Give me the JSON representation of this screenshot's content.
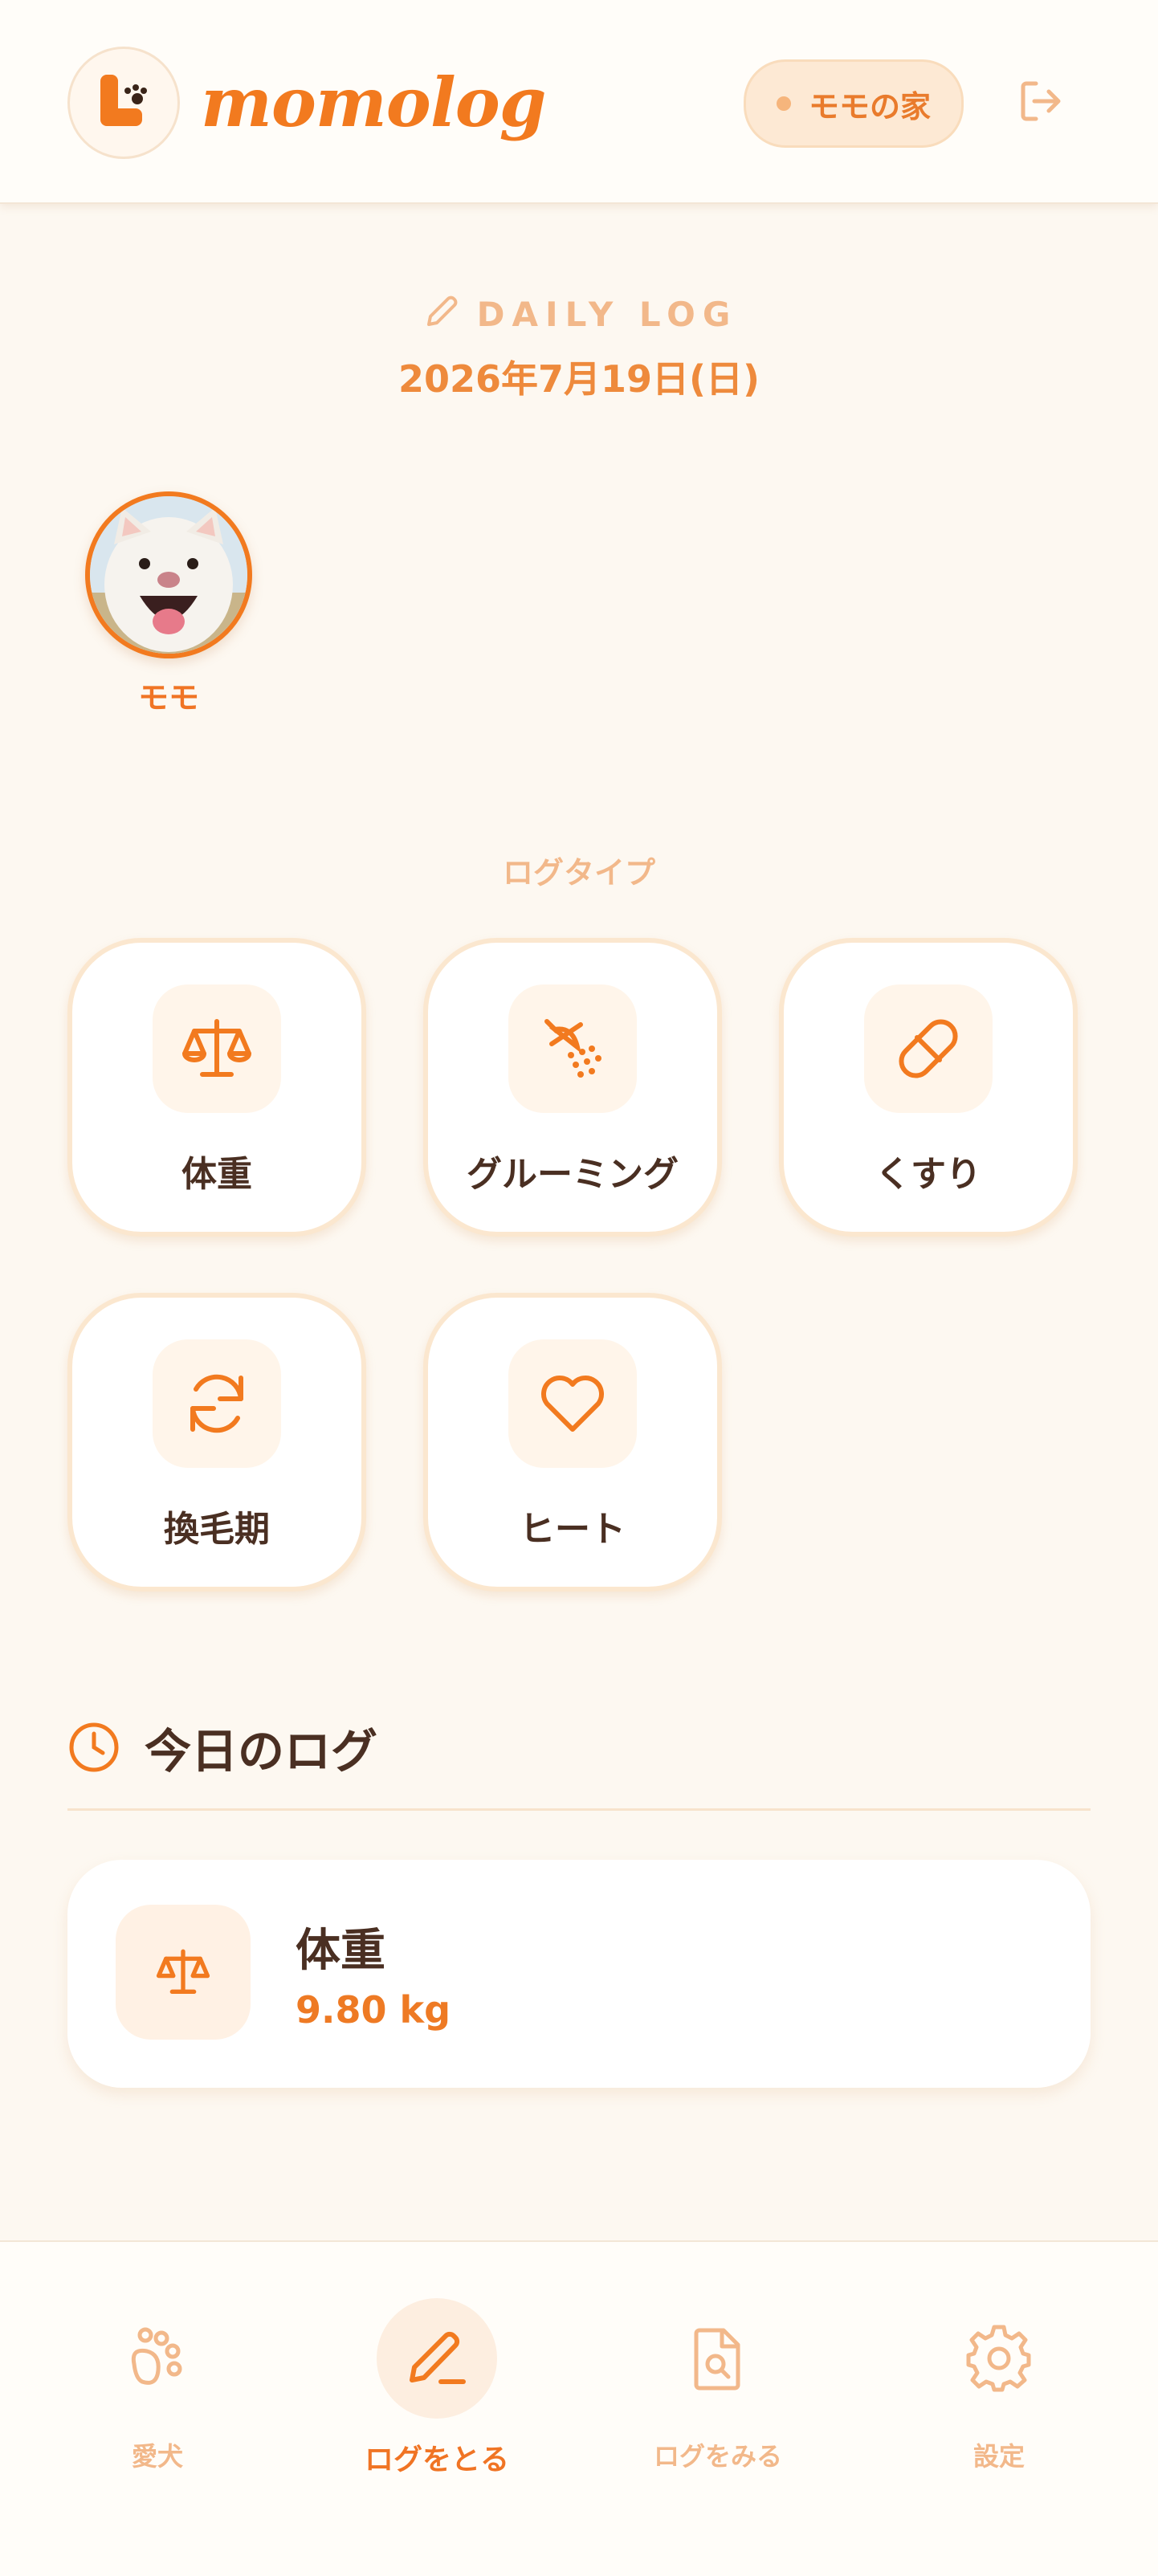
{
  "header": {
    "brand": "momolog",
    "household": "モモの家"
  },
  "log": {
    "heading": "DAILY LOG",
    "date": "2026年7月19日(日)"
  },
  "pet": {
    "name": "モモ"
  },
  "log_types": {
    "label": "ログタイプ",
    "items": [
      {
        "label": "体重",
        "icon": "scale-icon"
      },
      {
        "label": "グルーミング",
        "icon": "shower-icon"
      },
      {
        "label": "くすり",
        "icon": "pill-icon"
      },
      {
        "label": "換毛期",
        "icon": "refresh-icon"
      },
      {
        "label": "ヒート",
        "icon": "heart-icon"
      }
    ]
  },
  "today": {
    "heading": "今日のログ",
    "entries": [
      {
        "title": "体重",
        "value": "9.80 kg",
        "icon": "scale-icon"
      }
    ]
  },
  "nav": {
    "items": [
      {
        "label": "愛犬",
        "icon": "paw-icon",
        "active": false
      },
      {
        "label": "ログをとる",
        "icon": "pencil-icon",
        "active": true
      },
      {
        "label": "ログをみる",
        "icon": "document-search-icon",
        "active": false
      },
      {
        "label": "設定",
        "icon": "gear-icon",
        "active": false
      }
    ]
  },
  "colors": {
    "accent": "#f27a1f",
    "background": "#fdf8f1",
    "muted": "#f2b88a",
    "text": "#4a2f22"
  }
}
